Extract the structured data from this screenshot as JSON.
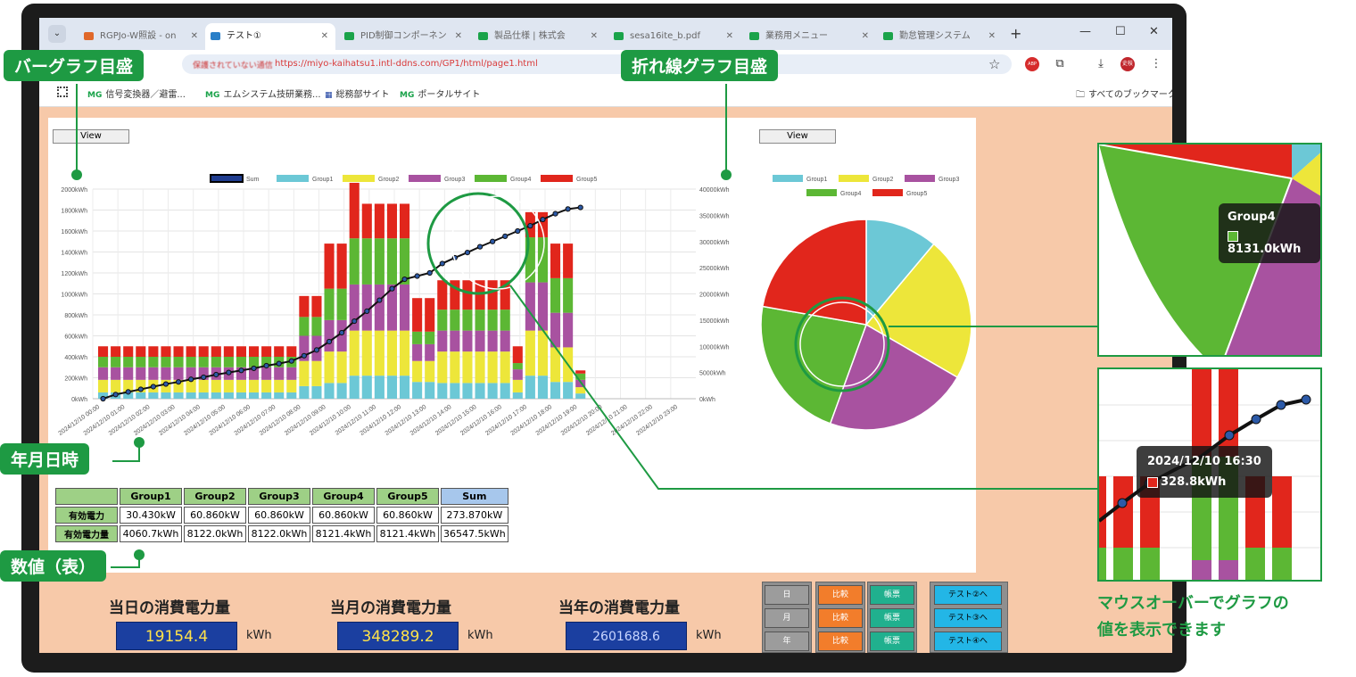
{
  "browser": {
    "tabs": [
      {
        "label": "RGPJo-W照設 - on"
      },
      {
        "label": "テスト①"
      },
      {
        "label": "PID制御コンポーネン"
      },
      {
        "label": "製品仕様 | 株式会"
      },
      {
        "label": "sesa16ite_b.pdf"
      },
      {
        "label": "業務用メニュー"
      },
      {
        "label": "勤怠管理システム"
      }
    ],
    "url": "https://miyo-kaihatsu1.intl-ddns.com/GP1/html/page1.html",
    "url_warning": "保護されていない通信",
    "bookmarks": [
      "信号変換器／避雷...",
      "エムシステム技研業務...",
      "総務部サイト",
      "ポータルサイト"
    ],
    "all_bookmarks": "すべてのブックマーク",
    "ext_abp": "ABP",
    "ext_user": "史枝"
  },
  "panel": {
    "view_left": "View",
    "view_right": "View"
  },
  "chart_data": [
    {
      "type": "bar",
      "title": "",
      "y_left_ticks": [
        "0kWh",
        "200kWh",
        "400kWh",
        "600kWh",
        "800kWh",
        "1000kWh",
        "1200kWh",
        "1400kWh",
        "1600kWh",
        "1800kWh",
        "2000kWh"
      ],
      "y_right_ticks": [
        "0kWh",
        "5000kWh",
        "10000kWh",
        "15000kWh",
        "20000kWh",
        "25000kWh",
        "30000kWh",
        "35000kWh",
        "40000kWh"
      ],
      "ylim_left": [
        0,
        2000
      ],
      "ylim_right": [
        0,
        40000
      ],
      "x_ticks": [
        "2024/12/10 00:00",
        "2024/12/10 01:00",
        "2024/12/10 02:00",
        "2024/12/10 03:00",
        "2024/12/10 04:00",
        "2024/12/10 05:00",
        "2024/12/10 06:00",
        "2024/12/10 07:00",
        "2024/12/10 08:00",
        "2024/12/10 09:00",
        "2024/12/10 10:00",
        "2024/12/10 11:00",
        "2024/12/10 12:00",
        "2024/12/10 13:00",
        "2024/12/10 14:00",
        "2024/12/10 15:00",
        "2024/12/10 16:00",
        "2024/12/10 17:00",
        "2024/12/10 18:00",
        "2024/12/10 19:00",
        "2024/12/10 20:00",
        "2024/12/10 21:00",
        "2024/12/10 22:00",
        "2024/12/10 23:00"
      ],
      "legend": [
        {
          "name": "Sum",
          "color": "#1f3c8f"
        },
        {
          "name": "Group1",
          "color": "#6cc8d6"
        },
        {
          "name": "Group2",
          "color": "#ede63a"
        },
        {
          "name": "Group3",
          "color": "#a852a0"
        },
        {
          "name": "Group4",
          "color": "#5cb734"
        },
        {
          "name": "Group5",
          "color": "#e1261c"
        }
      ],
      "stacks": [
        [
          60,
          120,
          120,
          100,
          100
        ],
        [
          60,
          120,
          120,
          100,
          100
        ],
        [
          60,
          120,
          120,
          100,
          100
        ],
        [
          60,
          120,
          120,
          100,
          100
        ],
        [
          60,
          120,
          120,
          100,
          100
        ],
        [
          60,
          120,
          120,
          100,
          100
        ],
        [
          60,
          120,
          120,
          100,
          100
        ],
        [
          60,
          120,
          120,
          100,
          100
        ],
        [
          60,
          120,
          120,
          100,
          100
        ],
        [
          60,
          120,
          120,
          100,
          100
        ],
        [
          60,
          120,
          120,
          100,
          100
        ],
        [
          60,
          120,
          120,
          100,
          100
        ],
        [
          60,
          120,
          120,
          100,
          100
        ],
        [
          60,
          120,
          120,
          100,
          100
        ],
        [
          60,
          120,
          120,
          100,
          100
        ],
        [
          60,
          120,
          120,
          100,
          100
        ],
        [
          120,
          240,
          240,
          180,
          200
        ],
        [
          120,
          240,
          240,
          180,
          200
        ],
        [
          150,
          300,
          300,
          300,
          430
        ],
        [
          150,
          300,
          300,
          300,
          430
        ],
        [
          220,
          430,
          440,
          440,
          530
        ],
        [
          220,
          430,
          440,
          440,
          330
        ],
        [
          220,
          430,
          440,
          440,
          330
        ],
        [
          220,
          430,
          440,
          440,
          330
        ],
        [
          220,
          430,
          440,
          440,
          330
        ],
        [
          160,
          200,
          160,
          120,
          320
        ],
        [
          160,
          200,
          160,
          120,
          320
        ],
        [
          150,
          300,
          200,
          200,
          280
        ],
        [
          150,
          300,
          200,
          200,
          280
        ],
        [
          150,
          300,
          200,
          200,
          280
        ],
        [
          150,
          300,
          200,
          200,
          280
        ],
        [
          150,
          300,
          200,
          200,
          280
        ],
        [
          150,
          300,
          200,
          200,
          280
        ],
        [
          60,
          120,
          100,
          60,
          160
        ],
        [
          220,
          430,
          460,
          430,
          240
        ],
        [
          220,
          430,
          460,
          430,
          240
        ],
        [
          160,
          330,
          330,
          330,
          330
        ],
        [
          160,
          330,
          330,
          330,
          330
        ],
        [
          50,
          60,
          70,
          60,
          30
        ]
      ],
      "sum_line": [
        0,
        800,
        1300,
        1800,
        2300,
        2800,
        3200,
        3700,
        4100,
        4600,
        5000,
        5400,
        5800,
        6300,
        6700,
        7200,
        8200,
        9300,
        10900,
        12600,
        14800,
        16700,
        18800,
        21000,
        22800,
        23400,
        24000,
        25800,
        26900,
        27900,
        29000,
        30000,
        31000,
        32000,
        33000,
        34200,
        35300,
        36200,
        36500
      ]
    },
    {
      "type": "pie",
      "legend": [
        {
          "name": "Group1",
          "color": "#6cc8d6"
        },
        {
          "name": "Group2",
          "color": "#ede63a"
        },
        {
          "name": "Group3",
          "color": "#a852a0"
        },
        {
          "name": "Group4",
          "color": "#5cb734"
        },
        {
          "name": "Group5",
          "color": "#e1261c"
        }
      ],
      "values": [
        4060.7,
        8122.0,
        8122.0,
        8121.4,
        8121.4
      ]
    }
  ],
  "table": {
    "headers": [
      "Group1",
      "Group2",
      "Group3",
      "Group4",
      "Group5",
      "Sum"
    ],
    "rows": [
      {
        "label": "有効電力",
        "cells": [
          "30.430kW",
          "60.860kW",
          "60.860kW",
          "60.860kW",
          "60.860kW",
          "273.870kW"
        ]
      },
      {
        "label": "有効電力量",
        "cells": [
          "4060.7kWh",
          "8122.0kWh",
          "8122.0kWh",
          "8121.4kWh",
          "8121.4kWh",
          "36547.5kWh"
        ]
      }
    ]
  },
  "totals": [
    {
      "label": "当日の消費電力量",
      "value": "19154.4",
      "unit": "kWh"
    },
    {
      "label": "当月の消費電力量",
      "value": "348289.2",
      "unit": "kWh"
    },
    {
      "label": "当年の消費電力量",
      "value": "2601688.6",
      "unit": "kWh"
    }
  ],
  "controls": {
    "period": [
      "日",
      "月",
      "年"
    ],
    "compare": [
      "比較",
      "比較",
      "比較"
    ],
    "report": [
      "帳票",
      "帳票",
      "帳票"
    ],
    "test": [
      "テスト②へ",
      "テスト③へ",
      "テスト④へ"
    ]
  },
  "callouts": {
    "bar_axis": "バーグラフ目盛",
    "line_axis": "折れ線グラフ目盛",
    "datetime": "年月日時",
    "table": "数値（表）",
    "note_line1": "マウスオーバーでグラフの",
    "note_line2": "値を表示できます"
  },
  "tooltips": {
    "pie_title": "Group4",
    "pie_value": "8131.0kWh",
    "bar_title": "2024/12/10 16:30",
    "bar_value": "328.8kWh"
  }
}
